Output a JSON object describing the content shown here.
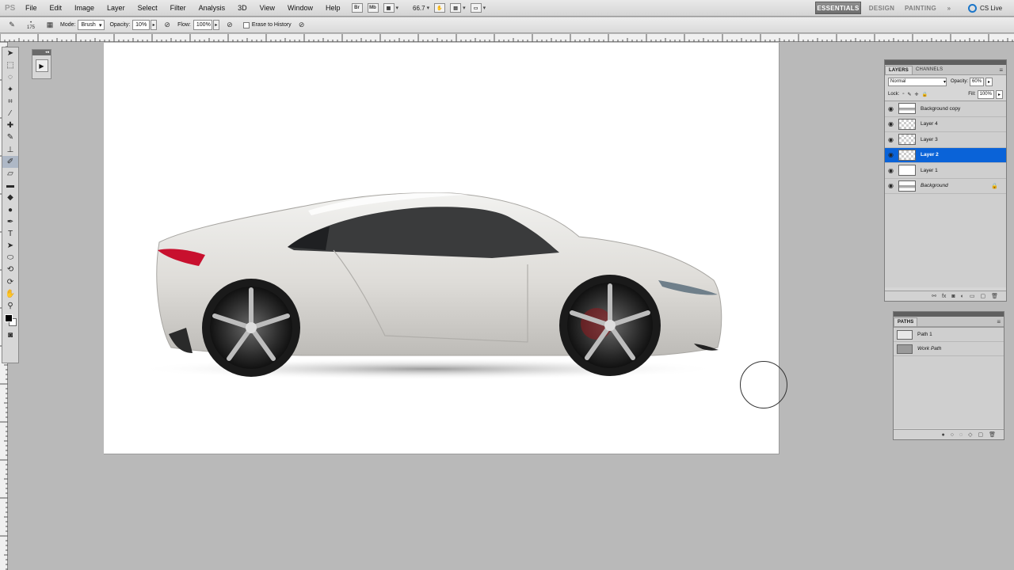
{
  "menubar": {
    "logo": "PS",
    "items": [
      "File",
      "Edit",
      "Image",
      "Layer",
      "Select",
      "Filter",
      "Analysis",
      "3D",
      "View",
      "Window",
      "Help"
    ],
    "tool_br": "Br",
    "tool_mb": "Mb",
    "zoom": "66.7",
    "workspaces": [
      "ESSENTIALS",
      "DESIGN",
      "PAINTING"
    ],
    "more": "»",
    "cs_live": "CS Live"
  },
  "options": {
    "brush_size": "175",
    "mode_label": "Mode:",
    "mode_value": "Brush",
    "opacity_label": "Opacity:",
    "opacity_value": "10%",
    "flow_label": "Flow:",
    "flow_value": "100%",
    "erase_label": "Erase to History"
  },
  "layers_panel": {
    "tabs": [
      "LAYERS",
      "CHANNELS"
    ],
    "blend_mode": "Normal",
    "opacity_label": "Opacity:",
    "opacity_value": "60%",
    "lock_label": "Lock:",
    "fill_label": "Fill:",
    "fill_value": "100%",
    "layers": [
      {
        "name": "Background copy"
      },
      {
        "name": "Layer 4"
      },
      {
        "name": "Layer 3"
      },
      {
        "name": "Layer 2"
      },
      {
        "name": "Layer 1"
      },
      {
        "name": "Background"
      }
    ]
  },
  "paths_panel": {
    "tab": "PATHS",
    "paths": [
      {
        "name": "Path 1"
      },
      {
        "name": "Work Path"
      }
    ]
  },
  "colors": {
    "selection": "#0a63d8",
    "workspace_bg": "#b9b9b9",
    "car_body": "#dddcd8",
    "taillight": "#c8102e"
  }
}
